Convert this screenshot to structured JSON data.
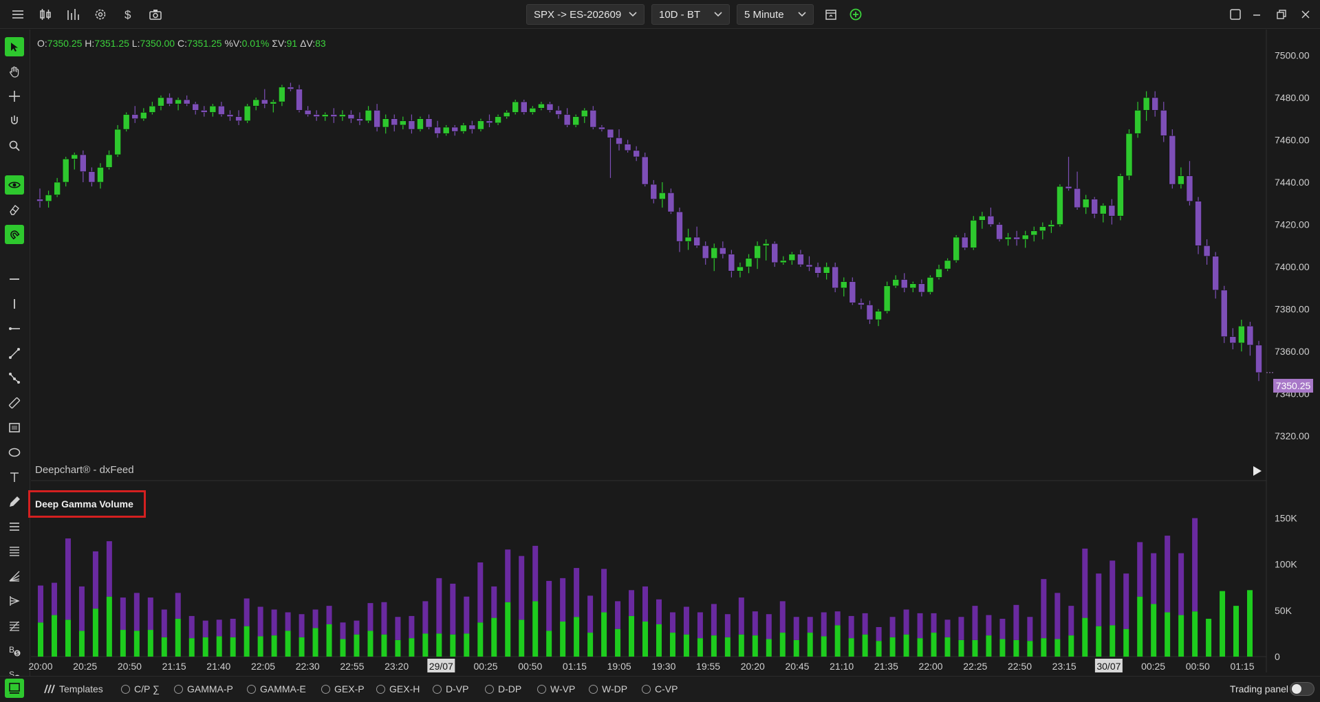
{
  "topbar": {
    "symbol": "SPX -> ES-202609",
    "range": "10D - BT",
    "interval": "5 Minute",
    "icons": [
      "menu-icon",
      "candlestick-icon",
      "bar-chart-icon",
      "gear-icon",
      "dollar-icon",
      "camera-icon"
    ]
  },
  "ohlc": {
    "o_label": "O:",
    "o": "7350.25",
    "h_label": "H:",
    "h": "7351.25",
    "l_label": "L:",
    "l": "7350.00",
    "c_label": "C:",
    "c": "7351.25",
    "pv_label": "%V:",
    "pv": "0.01%",
    "sv_label": "ΣV:",
    "sv": "91",
    "dv_label": "ΔV:",
    "dv": "83"
  },
  "watermark": "Deepchart® - dxFeed",
  "current_price": "7350.25",
  "panel_title": "Deep Gamma Volume",
  "price_axis": [
    "7500.00",
    "7480.00",
    "7460.00",
    "7440.00",
    "7420.00",
    "7400.00",
    "7380.00",
    "7360.00",
    "7340.00",
    "7320.00"
  ],
  "volume_axis": [
    "150K",
    "100K",
    "50K",
    "0"
  ],
  "time_axis": [
    "20:00",
    "20:25",
    "20:50",
    "21:15",
    "21:40",
    "22:05",
    "22:30",
    "22:55",
    "23:20",
    "29/07",
    "00:25",
    "00:50",
    "01:15",
    "19:05",
    "19:30",
    "19:55",
    "20:20",
    "20:45",
    "21:10",
    "21:35",
    "22:00",
    "22:25",
    "22:50",
    "23:15",
    "30/07",
    "00:25",
    "00:50",
    "01:15"
  ],
  "templates_label": "Templates",
  "templates": [
    "C/P ∑",
    "GAMMA-P",
    "GAMMA-E",
    "GEX-P",
    "GEX-H",
    "D-VP",
    "D-DP",
    "W-VP",
    "W-DP",
    "C-VP"
  ],
  "trading_panel_label": "Trading panel",
  "colors": {
    "up": "#2ec82e",
    "down": "#7e4fb8",
    "vol_up": "#1ecc1e",
    "vol_down": "#6a2aa0",
    "accent": "#2ec82e"
  },
  "chart_data": {
    "type": "candlestick",
    "ylim": [
      7310,
      7505
    ],
    "ohlc": [
      [
        7432,
        7437,
        7428,
        7431
      ],
      [
        7431,
        7436,
        7428,
        7434
      ],
      [
        7434,
        7442,
        7433,
        7440
      ],
      [
        7440,
        7452,
        7438,
        7451
      ],
      [
        7451,
        7454,
        7446,
        7453
      ],
      [
        7453,
        7455,
        7440,
        7445
      ],
      [
        7445,
        7447,
        7438,
        7440
      ],
      [
        7440,
        7449,
        7437,
        7447
      ],
      [
        7447,
        7455,
        7446,
        7453
      ],
      [
        7453,
        7467,
        7452,
        7465
      ],
      [
        7465,
        7473,
        7464,
        7472
      ],
      [
        7472,
        7476,
        7468,
        7470
      ],
      [
        7470,
        7475,
        7469,
        7473
      ],
      [
        7473,
        7478,
        7472,
        7476
      ],
      [
        7476,
        7481,
        7474,
        7480
      ],
      [
        7480,
        7482,
        7476,
        7477
      ],
      [
        7477,
        7480,
        7474,
        7479
      ],
      [
        7479,
        7481,
        7476,
        7477
      ],
      [
        7477,
        7478,
        7472,
        7474
      ],
      [
        7474,
        7476,
        7471,
        7473
      ],
      [
        7473,
        7477,
        7471,
        7476
      ],
      [
        7476,
        7478,
        7471,
        7472
      ],
      [
        7472,
        7474,
        7469,
        7471
      ],
      [
        7471,
        7474,
        7467,
        7469
      ],
      [
        7469,
        7477,
        7468,
        7476
      ],
      [
        7476,
        7480,
        7474,
        7479
      ],
      [
        7479,
        7484,
        7475,
        7477
      ],
      [
        7477,
        7479,
        7473,
        7478
      ],
      [
        7478,
        7486,
        7476,
        7485
      ],
      [
        7485,
        7487,
        7483,
        7484
      ],
      [
        7484,
        7486,
        7473,
        7474
      ],
      [
        7474,
        7476,
        7471,
        7472
      ],
      [
        7472,
        7474,
        7469,
        7471
      ],
      [
        7471,
        7473,
        7469,
        7472
      ],
      [
        7472,
        7475,
        7468,
        7471
      ],
      [
        7471,
        7474,
        7469,
        7472
      ],
      [
        7472,
        7474,
        7468,
        7470
      ],
      [
        7470,
        7473,
        7467,
        7469
      ],
      [
        7469,
        7476,
        7468,
        7474
      ],
      [
        7474,
        7477,
        7464,
        7466
      ],
      [
        7466,
        7472,
        7463,
        7470
      ],
      [
        7470,
        7472,
        7464,
        7467
      ],
      [
        7467,
        7471,
        7465,
        7469
      ],
      [
        7469,
        7472,
        7463,
        7465
      ],
      [
        7465,
        7471,
        7464,
        7470
      ],
      [
        7470,
        7472,
        7465,
        7466
      ],
      [
        7466,
        7469,
        7461,
        7463
      ],
      [
        7463,
        7467,
        7462,
        7466
      ],
      [
        7466,
        7467,
        7462,
        7464
      ],
      [
        7464,
        7468,
        7463,
        7467
      ],
      [
        7467,
        7469,
        7463,
        7465
      ],
      [
        7465,
        7470,
        7464,
        7469
      ],
      [
        7469,
        7472,
        7466,
        7468
      ],
      [
        7468,
        7472,
        7467,
        7471
      ],
      [
        7471,
        7474,
        7470,
        7473
      ],
      [
        7473,
        7479,
        7472,
        7478
      ],
      [
        7478,
        7479,
        7472,
        7473
      ],
      [
        7473,
        7476,
        7472,
        7475
      ],
      [
        7475,
        7478,
        7474,
        7477
      ],
      [
        7477,
        7478,
        7473,
        7474
      ],
      [
        7474,
        7476,
        7470,
        7472
      ],
      [
        7472,
        7475,
        7466,
        7467
      ],
      [
        7467,
        7472,
        7466,
        7471
      ],
      [
        7471,
        7475,
        7468,
        7474
      ],
      [
        7474,
        7476,
        7465,
        7466
      ],
      [
        7466,
        7467,
        7464,
        7465
      ],
      [
        7465,
        7461,
        7442,
        7461
      ],
      [
        7461,
        7465,
        7455,
        7458
      ],
      [
        7458,
        7460,
        7454,
        7455
      ],
      [
        7455,
        7457,
        7450,
        7452
      ],
      [
        7452,
        7454,
        7438,
        7439
      ],
      [
        7439,
        7441,
        7430,
        7432
      ],
      [
        7432,
        7440,
        7428,
        7435
      ],
      [
        7435,
        7437,
        7425,
        7426
      ],
      [
        7426,
        7428,
        7407,
        7412
      ],
      [
        7412,
        7418,
        7408,
        7414
      ],
      [
        7414,
        7419,
        7409,
        7410
      ],
      [
        7410,
        7412,
        7401,
        7404
      ],
      [
        7404,
        7411,
        7398,
        7409
      ],
      [
        7409,
        7412,
        7404,
        7406
      ],
      [
        7406,
        7408,
        7395,
        7398
      ],
      [
        7398,
        7402,
        7395,
        7400
      ],
      [
        7400,
        7406,
        7397,
        7404
      ],
      [
        7404,
        7412,
        7399,
        7410
      ],
      [
        7410,
        7413,
        7403,
        7411
      ],
      [
        7411,
        7412,
        7400,
        7402
      ],
      [
        7402,
        7405,
        7401,
        7403
      ],
      [
        7403,
        7407,
        7401,
        7406
      ],
      [
        7406,
        7408,
        7400,
        7401
      ],
      [
        7401,
        7405,
        7398,
        7400
      ],
      [
        7400,
        7402,
        7395,
        7397
      ],
      [
        7397,
        7402,
        7394,
        7400
      ],
      [
        7400,
        7402,
        7388,
        7390
      ],
      [
        7390,
        7395,
        7386,
        7393
      ],
      [
        7393,
        7395,
        7382,
        7383
      ],
      [
        7383,
        7385,
        7380,
        7382
      ],
      [
        7382,
        7384,
        7373,
        7375
      ],
      [
        7375,
        7380,
        7372,
        7379
      ],
      [
        7379,
        7393,
        7378,
        7391
      ],
      [
        7391,
        7396,
        7390,
        7394
      ],
      [
        7394,
        7397,
        7388,
        7390
      ],
      [
        7390,
        7393,
        7388,
        7392
      ],
      [
        7392,
        7394,
        7386,
        7388
      ],
      [
        7388,
        7396,
        7387,
        7395
      ],
      [
        7395,
        7401,
        7394,
        7399
      ],
      [
        7399,
        7404,
        7398,
        7403
      ],
      [
        7403,
        7415,
        7402,
        7414
      ],
      [
        7414,
        7416,
        7408,
        7409
      ],
      [
        7409,
        7424,
        7408,
        7422
      ],
      [
        7422,
        7426,
        7418,
        7424
      ],
      [
        7424,
        7428,
        7419,
        7420
      ],
      [
        7420,
        7421,
        7412,
        7413
      ],
      [
        7413,
        7416,
        7410,
        7414
      ],
      [
        7414,
        7417,
        7410,
        7413
      ],
      [
        7413,
        7417,
        7409,
        7415
      ],
      [
        7415,
        7419,
        7412,
        7417
      ],
      [
        7417,
        7421,
        7413,
        7419
      ],
      [
        7419,
        7422,
        7416,
        7420
      ],
      [
        7420,
        7439,
        7419,
        7438
      ],
      [
        7438,
        7452,
        7436,
        7437
      ],
      [
        7437,
        7445,
        7427,
        7428
      ],
      [
        7428,
        7434,
        7425,
        7432
      ],
      [
        7432,
        7433,
        7423,
        7425
      ],
      [
        7425,
        7430,
        7421,
        7429
      ],
      [
        7429,
        7432,
        7420,
        7424
      ],
      [
        7424,
        7444,
        7422,
        7443
      ],
      [
        7443,
        7465,
        7441,
        7463
      ],
      [
        7463,
        7478,
        7461,
        7474
      ],
      [
        7474,
        7483,
        7469,
        7480
      ],
      [
        7480,
        7483,
        7471,
        7474
      ],
      [
        7474,
        7478,
        7459,
        7462
      ],
      [
        7462,
        7465,
        7437,
        7439
      ],
      [
        7439,
        7447,
        7437,
        7443
      ],
      [
        7443,
        7450,
        7429,
        7431
      ],
      [
        7431,
        7433,
        7406,
        7410
      ],
      [
        7410,
        7413,
        7401,
        7405
      ],
      [
        7405,
        7407,
        7385,
        7389
      ],
      [
        7389,
        7391,
        7364,
        7367
      ],
      [
        7367,
        7371,
        7361,
        7364
      ],
      [
        7364,
        7375,
        7360,
        7372
      ],
      [
        7372,
        7374,
        7358,
        7363
      ],
      [
        7363,
        7365,
        7346,
        7350
      ]
    ],
    "volume": {
      "ylim": [
        0,
        175000
      ],
      "up": [
        37000,
        45000,
        40000,
        28000,
        52000,
        65000,
        29000,
        28000,
        29000,
        21000,
        41000,
        20000,
        21000,
        22000,
        21000,
        33000,
        22000,
        23000,
        28000,
        21000,
        31000,
        35000,
        19000,
        24000,
        28000,
        24000,
        18000,
        20000,
        25000,
        25000,
        24000,
        25000,
        37000,
        42000,
        59000,
        40000,
        60000,
        28000,
        38000,
        43000,
        26000,
        48000,
        30000,
        44000,
        38000,
        35000,
        26000,
        24000,
        20000,
        23000,
        21000,
        24000,
        23000,
        19000,
        26000,
        18000,
        26000,
        22000,
        34000,
        20000,
        24000,
        17000,
        21000,
        24000,
        20000,
        26000,
        21000,
        18000,
        18000,
        23000,
        19000,
        18000,
        17000,
        20000,
        19000,
        23000,
        42000,
        33000,
        34000,
        30000,
        65000,
        57000,
        48000,
        45000,
        49000,
        41000,
        71000,
        55000,
        72000
      ],
      "down": [
        40000,
        35000,
        88000,
        48000,
        62000,
        60000,
        35000,
        41000,
        35000,
        30000,
        28000,
        24000,
        18000,
        18000,
        20000,
        30000,
        32000,
        28000,
        20000,
        25000,
        20000,
        20000,
        18000,
        15000,
        30000,
        35000,
        25000,
        24000,
        35000,
        60000,
        55000,
        40000,
        65000,
        34000,
        57000,
        69000,
        60000,
        54000,
        47000,
        53000,
        40000,
        47000,
        30000,
        28000,
        38000,
        27000,
        22000,
        30000,
        28000,
        34000,
        25000,
        40000,
        26000,
        27000,
        34000,
        25000,
        17000,
        26000,
        15000,
        24000,
        23000,
        15000,
        22000,
        27000,
        27000,
        21000,
        19000,
        25000,
        37000,
        22000,
        22000,
        38000,
        26000,
        64000,
        50000,
        32000,
        75000,
        57000,
        70000,
        60000,
        59000,
        55000,
        83000,
        67000,
        101000
      ]
    }
  }
}
